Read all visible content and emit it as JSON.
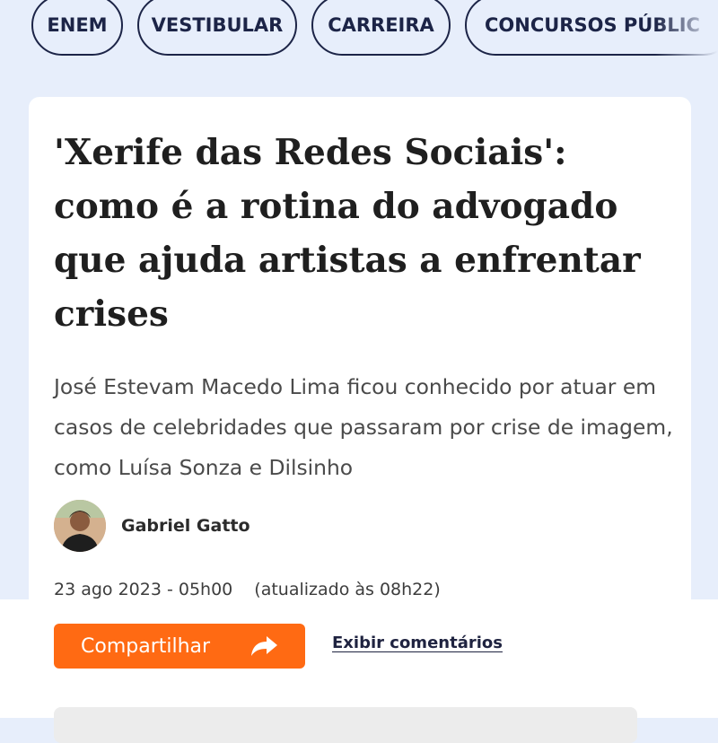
{
  "nav": {
    "tabs": [
      {
        "label": "ENEM"
      },
      {
        "label": "VESTIBULAR"
      },
      {
        "label": "CARREIRA"
      },
      {
        "label": "CONCURSOS PÚBLIC"
      }
    ]
  },
  "article": {
    "headline": "'Xerife das Redes Sociais': como é a rotina do advogado que ajuda artistas a enfrentar crises",
    "subtitle": "José Estevam Macedo Lima ficou conhecido por atuar em casos de celebridades que passaram por crise de imagem, como Luísa Sonza e Dilsinho",
    "author": {
      "name": "Gabriel Gatto",
      "avatar_icon": "author-avatar"
    },
    "date": "23 ago 2023 - 05h00",
    "updated": "(atualizado às 08h22)"
  },
  "actions": {
    "share_label": "Compartilhar",
    "share_icon": "share-arrow-icon",
    "comments_label": "Exibir comentários"
  },
  "colors": {
    "background": "#e7eefb",
    "accent": "#ff6a13",
    "navy": "#1c2447"
  }
}
